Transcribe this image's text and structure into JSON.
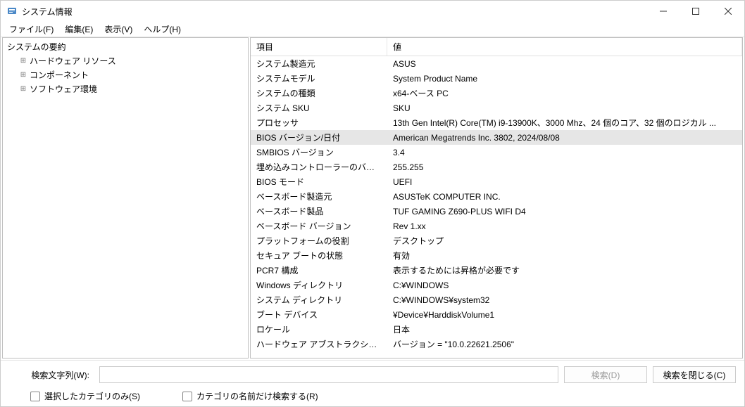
{
  "title": "システム情報",
  "menus": {
    "file": "ファイル(F)",
    "edit": "編集(E)",
    "view": "表示(V)",
    "help": "ヘルプ(H)"
  },
  "tree": {
    "root": "システムの要約",
    "children": {
      "hw": "ハードウェア リソース",
      "comp": "コンポーネント",
      "sw": "ソフトウェア環境"
    }
  },
  "columns": {
    "item": "項目",
    "value": "値"
  },
  "rows": [
    {
      "item": "システム製造元",
      "value": "ASUS"
    },
    {
      "item": "システムモデル",
      "value": "System Product Name"
    },
    {
      "item": "システムの種類",
      "value": "x64-ベース PC"
    },
    {
      "item": "システム SKU",
      "value": "SKU"
    },
    {
      "item": "プロセッサ",
      "value": "13th Gen Intel(R) Core(TM) i9-13900K、3000 Mhz、24 個のコア、32 個のロジカル ..."
    },
    {
      "item": "BIOS バージョン/日付",
      "value": "American Megatrends Inc. 3802, 2024/08/08",
      "selected": true
    },
    {
      "item": "SMBIOS バージョン",
      "value": "3.4"
    },
    {
      "item": "埋め込みコントローラーのバージョン",
      "value": "255.255"
    },
    {
      "item": "BIOS モード",
      "value": "UEFI"
    },
    {
      "item": "ベースボード製造元",
      "value": "ASUSTeK COMPUTER INC."
    },
    {
      "item": "ベースボード製品",
      "value": "TUF GAMING Z690-PLUS WIFI D4"
    },
    {
      "item": "ベースボード バージョン",
      "value": "Rev 1.xx"
    },
    {
      "item": "プラットフォームの役割",
      "value": "デスクトップ"
    },
    {
      "item": "セキュア ブートの状態",
      "value": "有効"
    },
    {
      "item": "PCR7 構成",
      "value": "表示するためには昇格が必要です"
    },
    {
      "item": "Windows ディレクトリ",
      "value": "C:¥WINDOWS"
    },
    {
      "item": "システム ディレクトリ",
      "value": "C:¥WINDOWS¥system32"
    },
    {
      "item": "ブート デバイス",
      "value": "¥Device¥HarddiskVolume1"
    },
    {
      "item": "ロケール",
      "value": "日本"
    },
    {
      "item": "ハードウェア アブストラクション レイヤー",
      "value": "バージョン = \"10.0.22621.2506\""
    }
  ],
  "search": {
    "label": "検索文字列(W):",
    "find": "検索(D)",
    "close": "検索を閉じる(C)",
    "chk1": "選択したカテゴリのみ(S)",
    "chk2": "カテゴリの名前だけ検索する(R)"
  }
}
